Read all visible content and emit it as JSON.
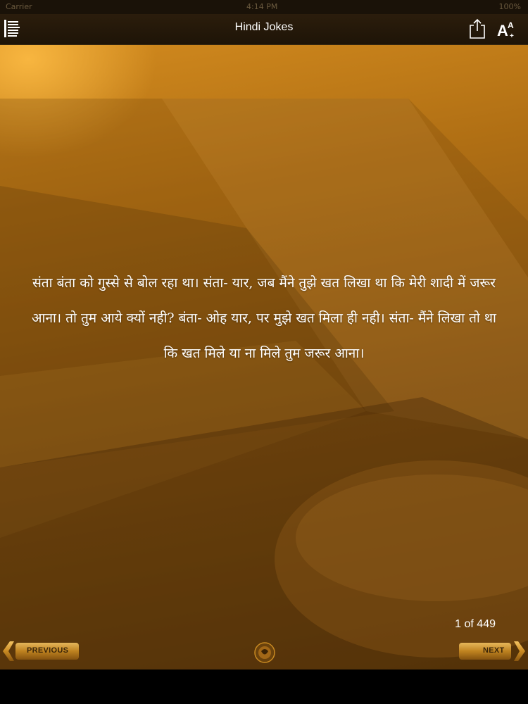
{
  "status_bar": {
    "carrier": "Carrier",
    "time": "4:14 PM",
    "battery": "100%"
  },
  "header": {
    "title": "Hindi Jokes"
  },
  "icons": {
    "menu": "list-icon",
    "share": "share-icon",
    "font": "font-size-icon",
    "logo": "emblem-icon"
  },
  "joke": {
    "text": "संता बंता को गुस्से से बोल रहा था। संता- यार, जब मैंने तुझे खत लिखा था कि मेरी शादी में जरूर आना। तो तुम आये क्यों नही? बंता- ओह यार, पर मुझे खत मिला ही नही। संता- मैंने लिखा तो था कि खत मिले या ना मिले तुम जरूर आना।"
  },
  "pagination": {
    "counter": "1 of 449",
    "previous_label": "PREVIOUS",
    "next_label": "NEXT"
  },
  "colors": {
    "nav_bg": "#1e1407",
    "content_gold": "#b06f14",
    "text": "#ffffff"
  }
}
